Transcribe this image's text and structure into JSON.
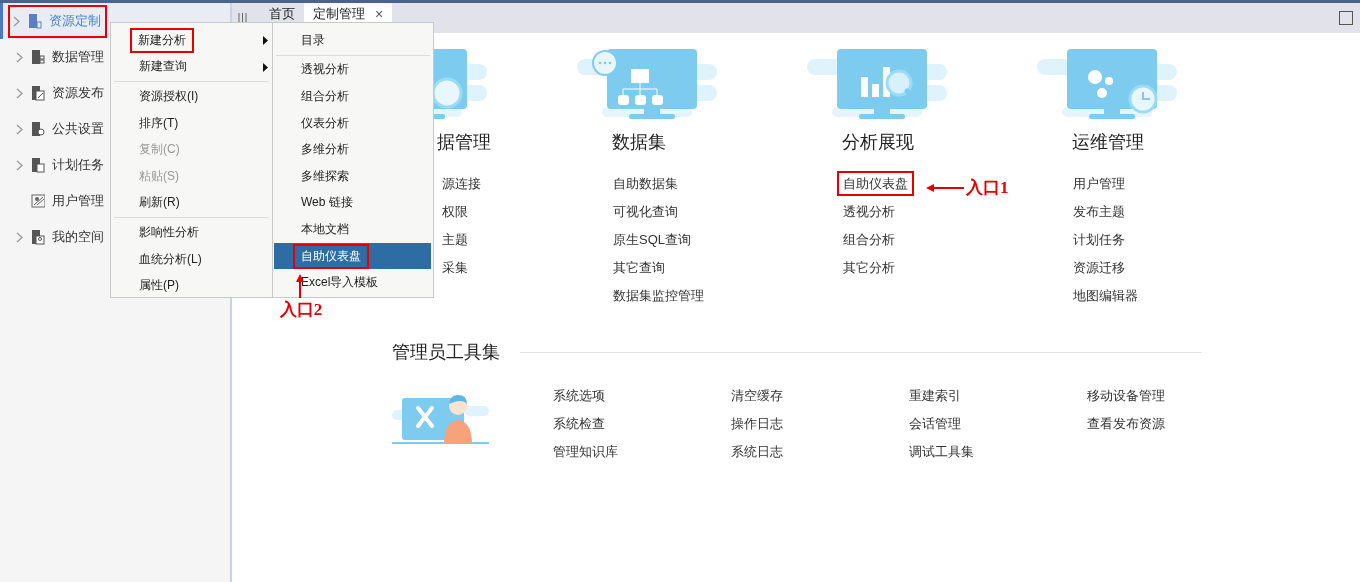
{
  "sidebar": {
    "items": [
      {
        "label": "资源定制",
        "expandable": true,
        "selected": true,
        "annotated": true
      },
      {
        "label": "数据管理",
        "expandable": true,
        "selected": false,
        "annotated": false
      },
      {
        "label": "资源发布",
        "expandable": true,
        "selected": false,
        "annotated": false
      },
      {
        "label": "公共设置",
        "expandable": true,
        "selected": false,
        "annotated": false
      },
      {
        "label": "计划任务",
        "expandable": true,
        "selected": false,
        "annotated": false
      },
      {
        "label": "用户管理",
        "expandable": false,
        "selected": false,
        "annotated": false
      },
      {
        "label": "我的空间",
        "expandable": true,
        "selected": false,
        "annotated": false
      }
    ]
  },
  "tabs": [
    {
      "label": "首页",
      "selected": false,
      "closable": false
    },
    {
      "label": "定制管理",
      "selected": true,
      "closable": true,
      "close": "×"
    }
  ],
  "context_menu": {
    "items": [
      {
        "kind": "item",
        "label": "新建分析",
        "has_submenu": true,
        "disabled": false,
        "annotated": true
      },
      {
        "kind": "item",
        "label": "新建查询",
        "has_submenu": true,
        "disabled": false,
        "annotated": false
      },
      {
        "kind": "separator"
      },
      {
        "kind": "item",
        "label": "资源授权(I)",
        "has_submenu": false,
        "disabled": false,
        "annotated": false
      },
      {
        "kind": "item",
        "label": "排序(T)",
        "has_submenu": false,
        "disabled": false,
        "annotated": false
      },
      {
        "kind": "item",
        "label": "复制(C)",
        "has_submenu": false,
        "disabled": true,
        "annotated": false
      },
      {
        "kind": "item",
        "label": "粘贴(S)",
        "has_submenu": false,
        "disabled": true,
        "annotated": false
      },
      {
        "kind": "item",
        "label": "刷新(R)",
        "has_submenu": false,
        "disabled": false,
        "annotated": false
      },
      {
        "kind": "separator"
      },
      {
        "kind": "item",
        "label": "影响性分析",
        "has_submenu": false,
        "disabled": false,
        "annotated": false
      },
      {
        "kind": "item",
        "label": "血统分析(L)",
        "has_submenu": false,
        "disabled": false,
        "annotated": false
      },
      {
        "kind": "item",
        "label": "属性(P)",
        "has_submenu": false,
        "disabled": false,
        "annotated": false
      }
    ]
  },
  "submenu": {
    "items": [
      {
        "kind": "item",
        "label": "目录",
        "selected": false,
        "annotated": false
      },
      {
        "kind": "separator"
      },
      {
        "kind": "item",
        "label": "透视分析",
        "selected": false,
        "annotated": false
      },
      {
        "kind": "item",
        "label": "组合分析",
        "selected": false,
        "annotated": false
      },
      {
        "kind": "item",
        "label": "仪表分析",
        "selected": false,
        "annotated": false
      },
      {
        "kind": "item",
        "label": "多维分析",
        "selected": false,
        "annotated": false
      },
      {
        "kind": "item",
        "label": "多维探索",
        "selected": false,
        "annotated": false
      },
      {
        "kind": "item",
        "label": "Web 链接",
        "selected": false,
        "annotated": false
      },
      {
        "kind": "item",
        "label": "本地文档",
        "selected": false,
        "annotated": false
      },
      {
        "kind": "item",
        "label": "自助仪表盘",
        "selected": true,
        "annotated": true
      },
      {
        "kind": "item",
        "label": "Excel导入模板",
        "selected": false,
        "annotated": false
      }
    ]
  },
  "modules": [
    {
      "title": "据管理",
      "partly_hidden": true,
      "links": [
        {
          "label": "源连接",
          "annotated": false
        },
        {
          "label": "权限",
          "annotated": false
        },
        {
          "label": "主题",
          "annotated": false
        },
        {
          "label": "采集",
          "annotated": false
        }
      ]
    },
    {
      "title": "数据集",
      "partly_hidden": false,
      "links": [
        {
          "label": "自助数据集",
          "annotated": false
        },
        {
          "label": "可视化查询",
          "annotated": false
        },
        {
          "label": "原生SQL查询",
          "annotated": false
        },
        {
          "label": "其它查询",
          "annotated": false
        },
        {
          "label": "数据集监控管理",
          "annotated": false
        }
      ]
    },
    {
      "title": "分析展现",
      "partly_hidden": false,
      "links": [
        {
          "label": "自助仪表盘",
          "annotated": true
        },
        {
          "label": "透视分析",
          "annotated": false
        },
        {
          "label": "组合分析",
          "annotated": false
        },
        {
          "label": "其它分析",
          "annotated": false
        }
      ]
    },
    {
      "title": "运维管理",
      "partly_hidden": false,
      "links": [
        {
          "label": "用户管理",
          "annotated": false
        },
        {
          "label": "发布主题",
          "annotated": false
        },
        {
          "label": "计划任务",
          "annotated": false
        },
        {
          "label": "资源迁移",
          "annotated": false
        },
        {
          "label": "地图编辑器",
          "annotated": false
        }
      ]
    }
  ],
  "admin_tools": {
    "title": "管理员工具集",
    "links": [
      "系统选项",
      "清空缓存",
      "重建索引",
      "移动设备管理",
      "系统检查",
      "操作日志",
      "会话管理",
      "查看发布资源",
      "管理知识库",
      "系统日志",
      "调试工具集"
    ]
  },
  "annotations": [
    {
      "kind": "left",
      "label": "入口1"
    },
    {
      "kind": "up",
      "label": "入口2"
    }
  ]
}
